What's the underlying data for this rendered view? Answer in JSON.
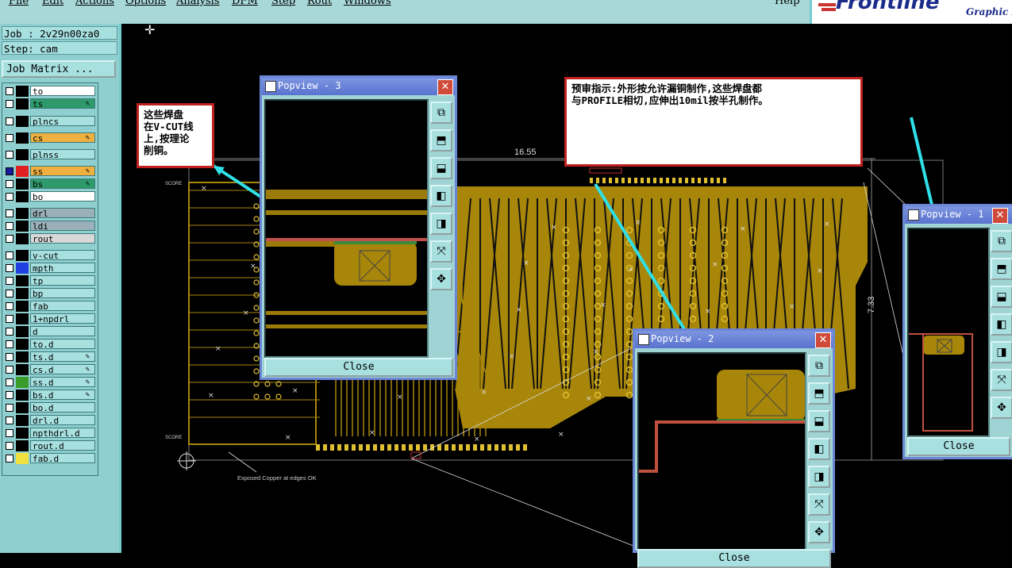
{
  "menu": [
    "File",
    "Edit",
    "Actions",
    "Options",
    "Analysis",
    "DFM",
    "Step",
    "Rout",
    "Windows"
  ],
  "help": "Help",
  "brand": {
    "logo": "Frontline",
    "sub": "Graphic E"
  },
  "job": {
    "job_line": "Job : 2v29n00za0",
    "step_line": "Step: cam",
    "matrix_button": "Job Matrix ..."
  },
  "layers": [
    {
      "name": "to",
      "color": "#ffffff",
      "swatch": "#000000"
    },
    {
      "name": "ts",
      "color": "#2e9a6a",
      "swatch": "#000000",
      "flag": "edit"
    },
    {
      "name": "plncs",
      "color": "#a8e0e0",
      "swatch": "#000000"
    },
    {
      "name": "cs",
      "color": "#f0b040",
      "swatch": "#000000",
      "flag": "edit"
    },
    {
      "name": "plnss",
      "color": "#a8e0e0",
      "swatch": "#000000"
    },
    {
      "name": "ss",
      "color": "#f0b040",
      "swatch": "#e02020",
      "flag": "edit",
      "active": true
    },
    {
      "name": "bs",
      "color": "#2e9a6a",
      "swatch": "#000000",
      "flag": "edit"
    },
    {
      "name": "bo",
      "color": "#ffffff",
      "swatch": "#000000"
    },
    {
      "name": "drl",
      "color": "#9ab0b8",
      "swatch": "#000000"
    },
    {
      "name": "ldi",
      "color": "#9ab0b8",
      "swatch": "#000000"
    },
    {
      "name": "rout",
      "color": "#d8d8d8",
      "swatch": "#000000"
    },
    {
      "name": "v-cut",
      "color": "#a8e0e0",
      "swatch": "#000000"
    },
    {
      "name": "mpth",
      "color": "#a8e0e0",
      "swatch": "#2040e0"
    },
    {
      "name": "tp",
      "color": "#a8e0e0",
      "swatch": "#000000"
    },
    {
      "name": "bp",
      "color": "#a8e0e0",
      "swatch": "#000000"
    },
    {
      "name": "fab",
      "color": "#a8e0e0",
      "swatch": "#000000"
    },
    {
      "name": "1+npdrl",
      "color": "#a8e0e0",
      "swatch": "#000000"
    },
    {
      "name": "d",
      "color": "#a8e0e0",
      "swatch": "#000000"
    },
    {
      "name": "to.d",
      "color": "#a8e0e0",
      "swatch": "#000000"
    },
    {
      "name": "ts.d",
      "color": "#a8e0e0",
      "swatch": "#000000",
      "flag": "edit"
    },
    {
      "name": "cs.d",
      "color": "#a8e0e0",
      "swatch": "#000000",
      "flag": "edit"
    },
    {
      "name": "ss.d",
      "color": "#a8e0e0",
      "swatch": "#3a9a2a",
      "flag": "edit"
    },
    {
      "name": "bs.d",
      "color": "#a8e0e0",
      "swatch": "#000000",
      "flag": "edit"
    },
    {
      "name": "bo.d",
      "color": "#a8e0e0",
      "swatch": "#000000"
    },
    {
      "name": "drl.d",
      "color": "#a8e0e0",
      "swatch": "#000000"
    },
    {
      "name": "npthdrl.d",
      "color": "#a8e0e0",
      "swatch": "#000000"
    },
    {
      "name": "rout.d",
      "color": "#a8e0e0",
      "swatch": "#000000"
    },
    {
      "name": "fab.d",
      "color": "#a8e0e0",
      "swatch": "#f0e040"
    }
  ],
  "notes": {
    "left": [
      "这些焊盘",
      "在V-CUT线",
      "上,按理论",
      "削铜。"
    ],
    "top": [
      "预审指示:外形按允许漏铜制作,这些焊盘都",
      "与PROFILE相切,应伸出10mil按半孔制作。"
    ]
  },
  "popviews": {
    "pv3": {
      "title": "Popview - 3",
      "close_label": "Close"
    },
    "pv2": {
      "title": "Popview - 2",
      "close_label": "Close"
    },
    "pv1": {
      "title": "Popview - 1",
      "close_label": "Close"
    }
  },
  "board": {
    "dim_top": "16.55",
    "dim_right": "7.33",
    "label_score": "SCORE",
    "exposed_note": "Exposed Copper at edges OK"
  },
  "tool_icons": [
    "zoom-in-icon",
    "pan-up-icon",
    "pan-down-icon",
    "pan-left-icon",
    "pan-right-icon",
    "zoom-fit-icon",
    "zoom-out-icon"
  ]
}
